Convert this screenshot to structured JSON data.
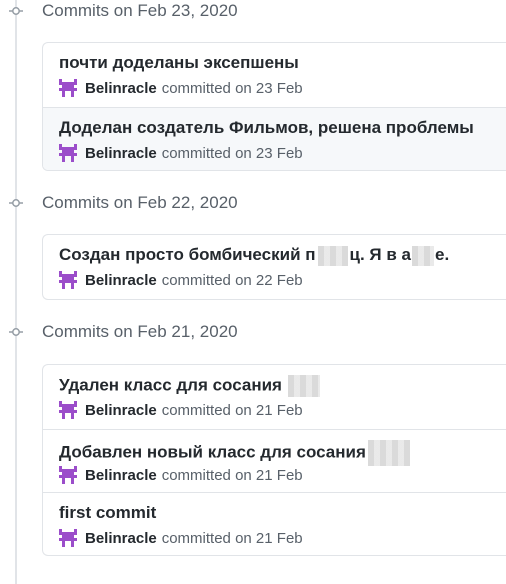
{
  "groups": [
    {
      "header": "Commits on Feb 23, 2020",
      "commits": [
        {
          "title": "почти доделаны эксепшены",
          "author": "Belinracle",
          "meta": "committed on 23 Feb"
        },
        {
          "title": "Доделан создатель Фильмов, решена проблемы",
          "author": "Belinracle",
          "meta": "committed on 23 Feb"
        }
      ]
    },
    {
      "header": "Commits on Feb 22, 2020",
      "commits": [
        {
          "title_a": "Создан просто бомбический п",
          "title_b": "ц. Я в а",
          "title_c": "е.",
          "author": "Belinracle",
          "meta": "committed on 22 Feb"
        }
      ]
    },
    {
      "header": "Commits on Feb 21, 2020",
      "commits": [
        {
          "title": "Удален класс для сосания",
          "author": "Belinracle",
          "meta": "committed on 21 Feb"
        },
        {
          "title": "Добавлен новый класс для сосания",
          "author": "Belinracle",
          "meta": "committed on 21 Feb"
        },
        {
          "title": "first commit",
          "author": "Belinracle",
          "meta": "committed on 21 Feb"
        }
      ]
    }
  ],
  "colors": {
    "avatar": "#9b4dca",
    "timeline": "#e1e4e8",
    "muted_text": "#586069"
  },
  "icons": {
    "node": "git-commit-icon",
    "avatar": "identicon-avatar"
  }
}
